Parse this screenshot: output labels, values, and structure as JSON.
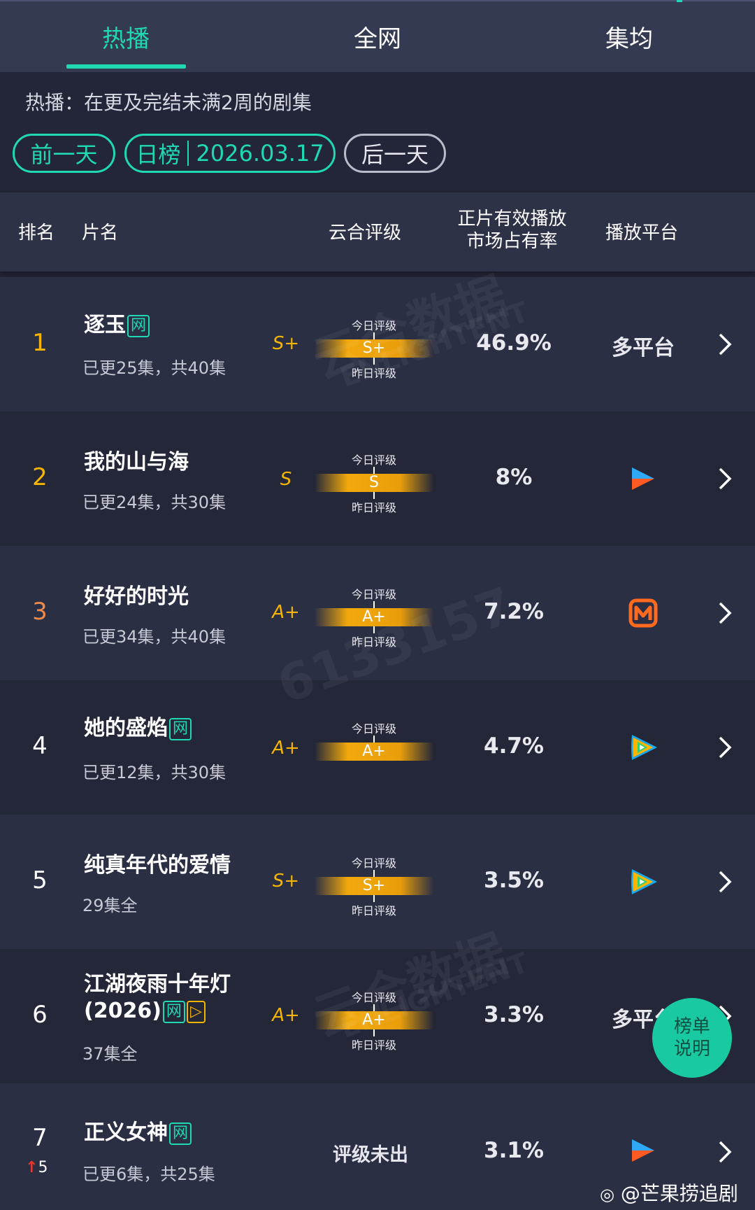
{
  "tabs": [
    {
      "label": "热播",
      "active": true
    },
    {
      "label": "全网",
      "active": false
    },
    {
      "label": "集均",
      "active": false
    }
  ],
  "info": {
    "description": "热播：在更及完结未满2周的剧集",
    "prev_day": "前一天",
    "board_type": "日榜",
    "date": "2026.03.17",
    "next_day": "后一天"
  },
  "table_header": {
    "rank": "排名",
    "title": "片名",
    "rating": "云合评级",
    "share_line1": "正片有效播放",
    "share_line2": "市场占有率",
    "platform": "播放平台"
  },
  "grade_labels": {
    "today": "今日评级",
    "yesterday": "昨日评级"
  },
  "rows": [
    {
      "rank": "1",
      "title": "逐玉",
      "badges": [
        "网"
      ],
      "episodes": "已更25集，共40集",
      "grade_prev": "S+",
      "grade_today": "S+",
      "share": "46.9%",
      "platform": "多平台",
      "platform_icon": "multi-platform-text"
    },
    {
      "rank": "2",
      "title": "我的山与海",
      "badges": [],
      "episodes": "已更24集，共30集",
      "grade_prev": "S",
      "grade_today": "S",
      "share": "8%",
      "platform": "",
      "platform_icon": "youku-icon"
    },
    {
      "rank": "3",
      "title": "好好的时光",
      "badges": [],
      "episodes": "已更34集，共40集",
      "grade_prev": "A+",
      "grade_today": "A+",
      "share": "7.2%",
      "platform": "",
      "platform_icon": "mango-tv-icon"
    },
    {
      "rank": "4",
      "title": "她的盛焰",
      "badges": [
        "网"
      ],
      "episodes": "已更12集，共30集",
      "grade_prev": "A+",
      "grade_today": "A+",
      "share": "4.7%",
      "platform": "",
      "platform_icon": "tencent-video-icon"
    },
    {
      "rank": "5",
      "title": "纯真年代的爱情",
      "badges": [],
      "episodes": "29集全",
      "grade_prev": "S+",
      "grade_today": "S+",
      "share": "3.5%",
      "platform": "",
      "platform_icon": "tencent-video-icon"
    },
    {
      "rank": "6",
      "title_line1": "江湖夜雨十年灯",
      "title_line2": "(2026)",
      "badges": [
        "网",
        "▷"
      ],
      "episodes": "37集全",
      "grade_prev": "A+",
      "grade_today": "A+",
      "share": "3.3%",
      "platform": "多平台",
      "platform_icon": "multi-platform-text"
    },
    {
      "rank": "7",
      "rank_change": "5",
      "title": "正义女神",
      "badges": [
        "网"
      ],
      "episodes": "已更6集，共25集",
      "grade_text": "评级未出",
      "share": "3.1%",
      "platform": "",
      "platform_icon": "youku-icon"
    }
  ],
  "fab": {
    "line1": "榜单",
    "line2": "说明"
  },
  "watermark": {
    "brand": "云合数据",
    "brand_en": "ENLIGHTENT",
    "id": "6133157"
  },
  "weibo_handle": "@芒果捞追剧",
  "colors": {
    "accent": "#1fd8b4",
    "gold": "#f4b400",
    "rank1": "#f4b400",
    "rank3": "#f08a4b",
    "rank_up": "#e6362d"
  }
}
